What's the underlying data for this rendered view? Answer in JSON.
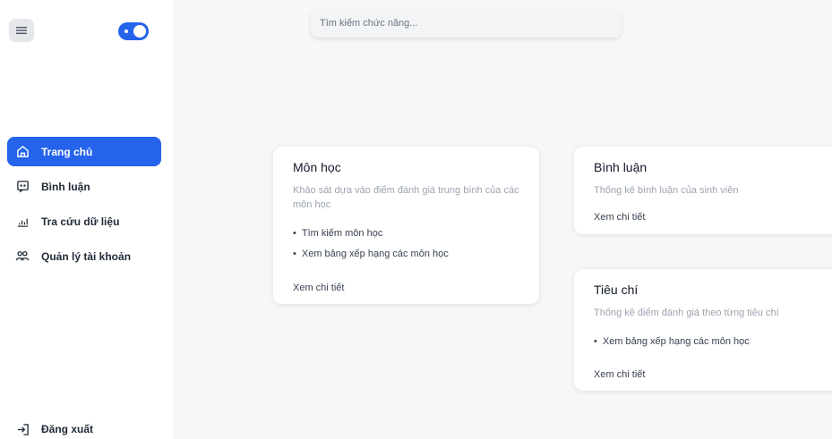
{
  "search": {
    "placeholder": "Tìm kiếm chức năng..."
  },
  "sidebar": {
    "items": [
      {
        "label": "Trang chủ",
        "icon": "home-icon",
        "active": true
      },
      {
        "label": "Bình luận",
        "icon": "comment-icon",
        "active": false
      },
      {
        "label": "Tra cứu dữ liệu",
        "icon": "chart-icon",
        "active": false
      },
      {
        "label": "Quản lý tài khoản",
        "icon": "users-icon",
        "active": false
      }
    ],
    "logout_label": "Đăng xuất"
  },
  "cards": {
    "mon_hoc": {
      "title": "Môn học",
      "description": "Khảo sát dựa vào điểm đánh giá trung bình của các môn học",
      "bullets": [
        "Tìm kiếm môn học",
        "Xem bảng xếp hạng các môn học"
      ],
      "link": "Xem chi tiết"
    },
    "binh_luan": {
      "title": "Bình luận",
      "description": "Thống kê bình luận của sinh viên",
      "link": "Xem chi tiết"
    },
    "tieu_chi": {
      "title": "Tiêu chí",
      "description": "Thống kê điểm đánh giá theo từng tiêu chí",
      "bullets": [
        "Xem bảng xếp hạng các môn học"
      ],
      "link": "Xem chi tiết"
    }
  },
  "colors": {
    "accent": "#2563eb",
    "background": "#f7f7f8"
  }
}
